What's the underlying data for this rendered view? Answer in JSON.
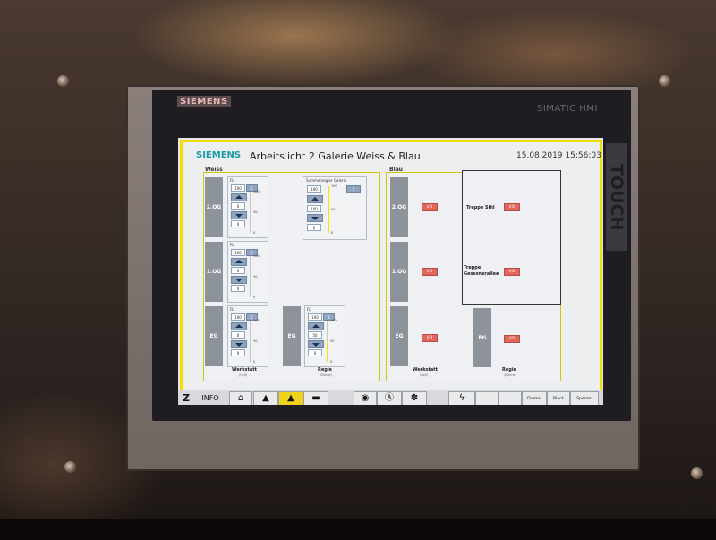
{
  "device": {
    "brand": "SIEMENS",
    "model": "SIMATIC HMI",
    "side": "TOUCH"
  },
  "header": {
    "brand": "SIEMENS",
    "title": "Arbeitslicht 2 Galerie Weiss & Blau",
    "datetime": "15.08.2019 15:56:03"
  },
  "weiss": {
    "label": "Weiss",
    "floors": [
      "2.OG",
      "1.OG",
      "EG"
    ],
    "dimmers": [
      {
        "label": "FL",
        "value": "100",
        "sigma": "Σ",
        "field2": "0",
        "field3": "0",
        "scale_top": "100",
        "scale_mid": "50",
        "scale_bot": "0",
        "level": 0
      },
      {
        "label": "FL",
        "value": "100",
        "sigma": "Σ",
        "field2": "0",
        "field3": "0",
        "scale_top": "100",
        "scale_mid": "50",
        "scale_bot": "0",
        "level": 0
      },
      {
        "label": "FL",
        "value": "100",
        "sigma": "Σ",
        "field2": "0",
        "field3": "0",
        "scale_top": "100",
        "scale_mid": "50",
        "scale_bot": "0",
        "level": 0
      }
    ],
    "sum_panel": {
      "label": "Summenregler Galerie",
      "value": "100",
      "sigma": "Σ",
      "field2": "100",
      "field3": "0",
      "scale_top": "100",
      "scale_mid": "50",
      "scale_bot": "0",
      "level": 1.0
    },
    "regie_panel": {
      "floor": "EG",
      "label": "FL",
      "value": "100",
      "sigma": "Σ",
      "field2": "50",
      "field3": "0",
      "scale_top": "100",
      "scale_mid": "50",
      "scale_bot": "0",
      "level": 0.5
    },
    "werkstatt": {
      "label": "Werkstatt",
      "sub": "(hell)"
    },
    "regie": {
      "label": "Regie",
      "sub": "(Bühne)"
    }
  },
  "blau": {
    "label": "Blau",
    "floors": [
      "2.OG",
      "1.OG",
      "EG"
    ],
    "io_label": "I/O",
    "treppe_sihl": "Treppe Sihl",
    "treppe_gess_1": "Treppe",
    "treppe_gess_2": "Gesssnerallee",
    "regie_floor": "EG",
    "werkstatt": {
      "label": "Werkstatt",
      "sub": "(hell)"
    },
    "regie": {
      "label": "Regie",
      "sub": "(Bühne)"
    }
  },
  "toolbar": {
    "z": "Z",
    "info": "INFO",
    "home_icon": "home-icon",
    "dunkel": "Dunkel",
    "black": "Black",
    "sperren": "Sperren"
  }
}
